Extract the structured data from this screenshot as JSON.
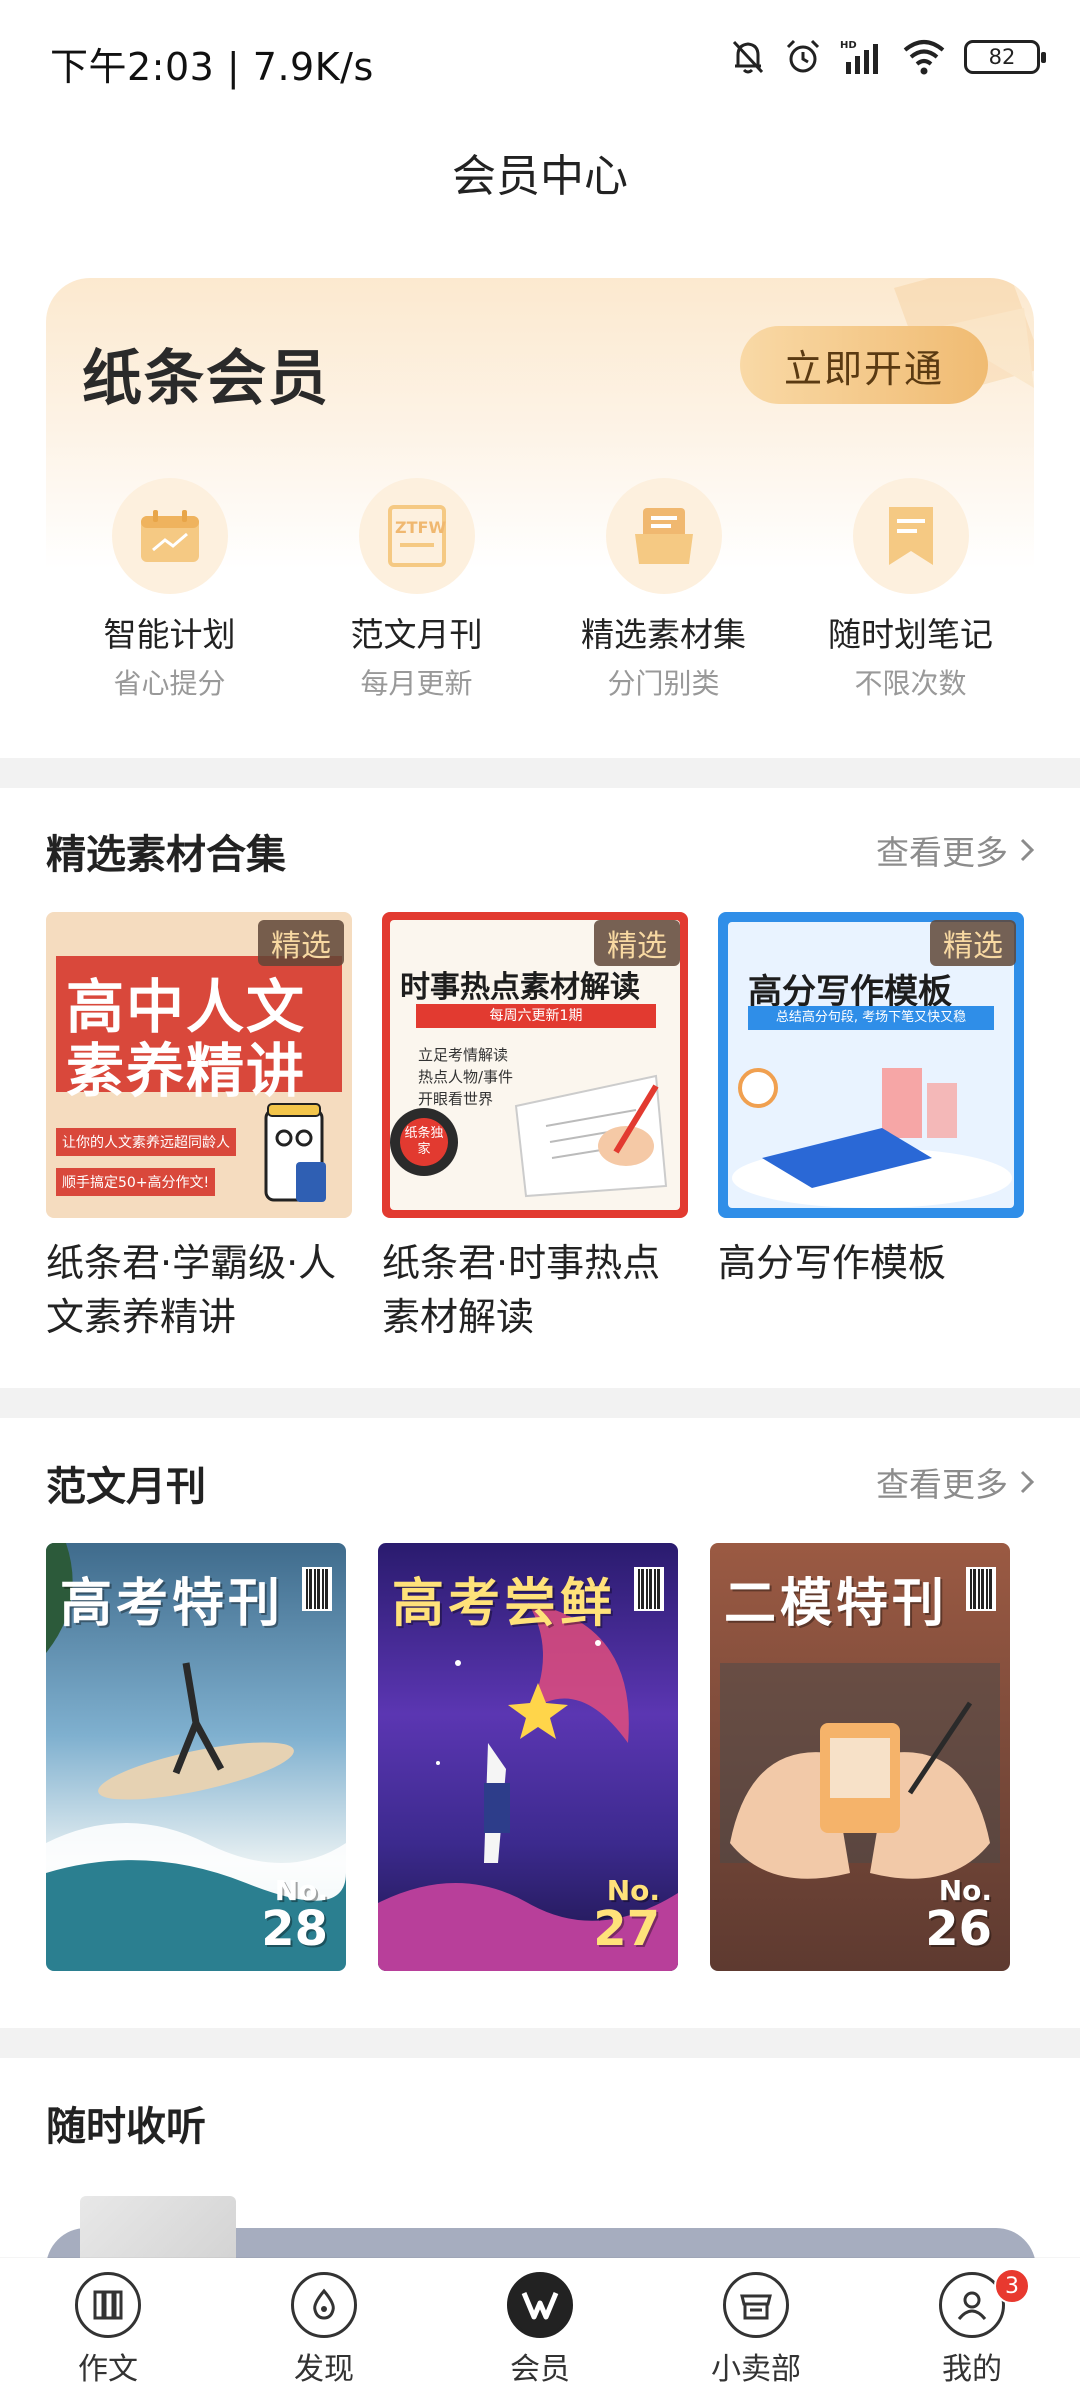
{
  "status_bar": {
    "time": "下午2:03 | 7.9K/s",
    "battery": "82"
  },
  "page_title": "会员中心",
  "member_card": {
    "title": "纸条会员",
    "open_button": "立即开通",
    "benefits": [
      {
        "title": "智能计划",
        "subtitle": "省心提分",
        "icon": "calendar-icon"
      },
      {
        "title": "范文月刊",
        "subtitle": "每月更新",
        "icon": "ztfw-magazine-icon"
      },
      {
        "title": "精选素材集",
        "subtitle": "分门别类",
        "icon": "folder-icon"
      },
      {
        "title": "随时划笔记",
        "subtitle": "不限次数",
        "icon": "bookmark-icon"
      }
    ]
  },
  "materials_section": {
    "title": "精选素材合集",
    "see_more": "查看更多",
    "items": [
      {
        "tag": "精选",
        "title": "纸条君·学霸级·人文素养精讲",
        "cover_text_1": "高中人文",
        "cover_text_2": "素养精讲",
        "cover_caption_1": "让你的人文素养远超同龄人",
        "cover_caption_2": "顺手搞定50+高分作文!"
      },
      {
        "tag": "精选",
        "title": "纸条君·时事热点素材解读",
        "cover_text_1": "时事热点素材解读",
        "cover_caption_1": "每周六更新1期",
        "cover_lines": [
          "立足考情解读",
          "热点人物/事件",
          "开眼看世界"
        ],
        "cover_badge": "纸条独家"
      },
      {
        "tag": "精选",
        "title": "高分写作模板",
        "cover_text_1": "高分写作模板",
        "cover_caption_1": "总结高分句段, 考场下笔又快又稳"
      }
    ]
  },
  "monthly_section": {
    "title": "范文月刊",
    "see_more": "查看更多",
    "items": [
      {
        "title": "高考特刊",
        "no_label": "No.",
        "no": "28"
      },
      {
        "title": "高考尝鲜",
        "no_label": "No.",
        "no": "27"
      },
      {
        "title": "二模特刊",
        "no_label": "No.",
        "no": "26"
      }
    ]
  },
  "listen_section": {
    "title": "随时收听"
  },
  "bottom_nav": {
    "items": [
      {
        "label": "作文",
        "icon": "essay-icon"
      },
      {
        "label": "发现",
        "icon": "discover-icon"
      },
      {
        "label": "会员",
        "icon": "member-icon",
        "active": true
      },
      {
        "label": "小卖部",
        "icon": "shop-icon"
      },
      {
        "label": "我的",
        "icon": "profile-icon",
        "badge": "3"
      }
    ]
  },
  "colors": {
    "accent_gold": "#f0bb72",
    "badge_red": "#e8392f",
    "divider": "#f2f2f2"
  }
}
